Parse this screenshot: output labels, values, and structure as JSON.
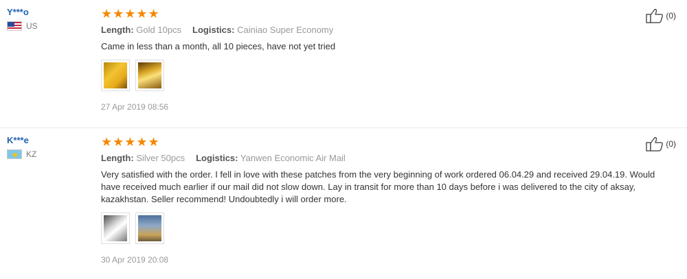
{
  "reviews": [
    {
      "user": "Y***o",
      "country": "US",
      "stars": "★★★★★",
      "length_label": "Length:",
      "length_value": "Gold 10pcs",
      "logistics_label": "Logistics:",
      "logistics_value": "Cainiao Super Economy",
      "text": "Came in less than a month, all 10 pieces, have not yet tried",
      "date": "27 Apr 2019 08:56",
      "likes": "(0)",
      "photos": [
        "gold-patch-photo",
        "gold-patch-photo"
      ]
    },
    {
      "user": "K***e",
      "country": "KZ",
      "stars": "★★★★★",
      "length_label": "Length:",
      "length_value": "Silver 50pcs",
      "logistics_label": "Logistics:",
      "logistics_value": "Yanwen Economic Air Mail",
      "text": "Very satisfied with the order. I fell in love with these patches from the very beginning of work ordered 06.04.29 and received 29.04.19. Would have received much earlier if our mail did not slow down. Lay in transit for more than 10 days before i was delivered to the city of aksay, kazakhstan. Seller recommend! Undoubtedly i will order more.",
      "date": "30 Apr 2019 20:08",
      "likes": "(0)",
      "photos": [
        "silver-patch-photo",
        "silver-patch-photo"
      ]
    }
  ],
  "colors": {
    "star": "#f58800",
    "username": "#1f62b0",
    "muted": "#999999"
  }
}
